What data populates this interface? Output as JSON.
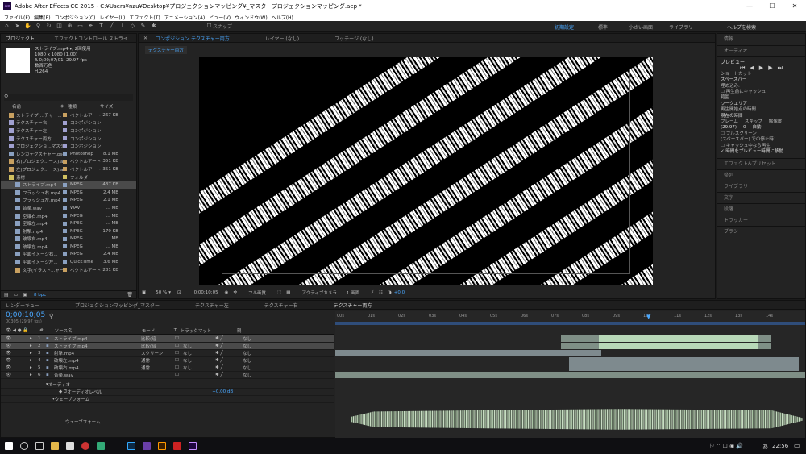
{
  "window": {
    "title": "Adobe After Effects CC 2015 - C:¥Users¥nzu¥Desktop¥プロジェクションマッピング¥_マスタープロジェクションマッピング.aep *",
    "app_icon": "Ae"
  },
  "menu": [
    "ファイル(F)",
    "編集(E)",
    "コンポジション(C)",
    "レイヤー(L)",
    "エフェクト(T)",
    "アニメーション(A)",
    "ビュー(V)",
    "ウィンドウ(W)",
    "ヘルプ(H)"
  ],
  "toolbar": {
    "snap_label": "スナップ",
    "workspaces": [
      "初期設定",
      "標準",
      "小さい画面",
      "ライブラリ"
    ],
    "search_placeholder": "ヘルプを検索"
  },
  "project": {
    "tabs": [
      "プロジェクト",
      "エフェクトコントロール ストライ"
    ],
    "selected_name": "ストライプ.mp4 ▾",
    "selected_used": ", 2回使用",
    "info1": "1080 x 1080 (1.00)",
    "info2": "Δ 0;00;07;01, 29.97 fps",
    "info3": "数百万色",
    "info4": "H.264",
    "search_icon": "search-icon",
    "columns": [
      "名前",
      "種類",
      "サイズ"
    ],
    "items": [
      {
        "name": "ストライプ(...チャー...",
        "type": "ベクトルアート",
        "size": "267 KB",
        "color": "#c8a060"
      },
      {
        "name": "テクスチャー右",
        "type": "コンポジション",
        "size": "",
        "color": "#a0a0d0"
      },
      {
        "name": "テクスチャー左",
        "type": "コンポジション",
        "size": "",
        "color": "#a0a0d0"
      },
      {
        "name": "テクスチャー両方",
        "type": "コンポジション",
        "size": "",
        "color": "#a0a0d0"
      },
      {
        "name": "プロジェクショ...マスター",
        "type": "コンポジション",
        "size": "",
        "color": "#a0a0d0"
      },
      {
        "name": "レンガテクスチャー.psd",
        "type": "Photoshop",
        "size": "8.1 MB",
        "color": "#8aa0c0"
      },
      {
        "name": "右(プロジェク...ース).ai",
        "type": "ベクトルアート",
        "size": "351 KB",
        "color": "#c8a060"
      },
      {
        "name": "左(プロジェク...ース).ai",
        "type": "ベクトルアート",
        "size": "351 KB",
        "color": "#c8a060"
      },
      {
        "name": "素材",
        "type": "フォルダー",
        "size": "",
        "color": "#d0c060"
      },
      {
        "name": "ストライプ.mp4",
        "type": "MPEG",
        "size": "437 KB",
        "color": "#8aa0c0"
      },
      {
        "name": "フラッシュ右.mp4",
        "type": "MPEG",
        "size": "2.4 MB",
        "color": "#8aa0c0"
      },
      {
        "name": "フラッシュ左.mp4",
        "type": "MPEG",
        "size": "2.1 MB",
        "color": "#8aa0c0"
      },
      {
        "name": "音楽.wav",
        "type": "WAV",
        "size": "... MB",
        "color": "#8aa0c0"
      },
      {
        "name": "空爆右.mp4",
        "type": "MPEG",
        "size": "... MB",
        "color": "#8aa0c0"
      },
      {
        "name": "空爆左.mp4",
        "type": "MPEG",
        "size": "... MB",
        "color": "#8aa0c0"
      },
      {
        "name": "射撃.mp4",
        "type": "MPEG",
        "size": "179 KB",
        "color": "#8aa0c0"
      },
      {
        "name": "破壊右.mp4",
        "type": "MPEG",
        "size": "... MB",
        "color": "#8aa0c0"
      },
      {
        "name": "破壊左.mp4",
        "type": "MPEG",
        "size": "... MB",
        "color": "#8aa0c0"
      },
      {
        "name": "平面イメージ右...",
        "type": "MPEG",
        "size": "2.4 MB",
        "color": "#8aa0c0"
      },
      {
        "name": "平面イメージ左...",
        "type": "QuickTime",
        "size": "3.6 MB",
        "color": "#8aa0c0"
      },
      {
        "name": "文字(イラスト...ャー...",
        "type": "ベクトルアート",
        "size": "281 KB",
        "color": "#c8a060"
      }
    ],
    "bpc": "8 bpc"
  },
  "viewer": {
    "tabs": [
      "コンポジション テクスチャー両方",
      "レイヤー (なし)",
      "フッテージ (なし)"
    ],
    "comp_tab": "テクスチャー両方",
    "zoom": "50 %",
    "timecode": "0;00;10;05",
    "resolution": "フル画質",
    "camera": "アクティブカメラ",
    "views": "1 画面",
    "offset": "+0.0"
  },
  "right_panel": {
    "tabs": [
      "情報",
      "オーディオ"
    ],
    "preview_title": "プレビュー",
    "shortcut_label": "ショートカット",
    "shortcut_value": "スペースバー",
    "include_label": "埋め込み:",
    "cache_label": "再生前にキャッシュ",
    "range_label": "範囲",
    "range_value": "ワークエリア",
    "start_label": "再生開始点の時間",
    "start_value": "現在の時間",
    "frame_label": "フレーム",
    "skip_label": "スキップ",
    "res_label": "解像度",
    "frame_value": "(29.97)",
    "skip_value": "0",
    "res_value": "自動",
    "fullscreen": "フルスクリーン",
    "stop_label": "(スペースバー) での停止時：",
    "cache_play": "キャッシュ中なら再生",
    "move_time": "時間をプレビュー時間に移動",
    "panels": [
      "エフェクト&プリセット",
      "整列",
      "ライブラリ",
      "文字",
      "段落",
      "トラッカー",
      "ブラシ"
    ]
  },
  "timeline": {
    "tabs": [
      "レンダーキュー",
      "プロジェクションマッピング_マスター",
      "テクスチャー左",
      "テクスチャー右",
      "テクスチャー両方"
    ],
    "timecode": "0;00;10;05",
    "fps": "00305 (29.97 fps)",
    "col_name": "ソース名",
    "col_mode": "モード",
    "col_t": "T",
    "col_track": "トラックマット",
    "col_parent": "親",
    "ruler": [
      "00s",
      "01s",
      "02s",
      "03s",
      "04s",
      "05s",
      "06s",
      "07s",
      "08s",
      "09s",
      "10s",
      "11s",
      "12s",
      "13s",
      "14s"
    ],
    "layers": [
      {
        "num": "1",
        "name": "ストライプ.mp4",
        "mode": "比較(暗",
        "track": "",
        "parent": "なし"
      },
      {
        "num": "2",
        "name": "ストライプ.mp4",
        "mode": "比較(暗",
        "track": "なし",
        "parent": "なし"
      },
      {
        "num": "3",
        "name": "射撃.mp4",
        "mode": "スクリーン",
        "track": "なし",
        "parent": "なし"
      },
      {
        "num": "4",
        "name": "破壊左.mp4",
        "mode": "通常",
        "track": "なし",
        "parent": "なし"
      },
      {
        "num": "5",
        "name": "破壊右.mp4",
        "mode": "通常",
        "track": "なし",
        "parent": "なし"
      },
      {
        "num": "6",
        "name": "音楽.wav",
        "mode": "",
        "track": "",
        "parent": "なし"
      }
    ],
    "audio_label": "オーディオ",
    "audio_level_label": "オーディオレベル",
    "audio_level_value": "+0.00 dB",
    "waveform_label": "ウェーブフォーム",
    "waveform_label2": "ウェーブフォーム"
  },
  "taskbar": {
    "time": "22:56",
    "ime": "あ"
  }
}
